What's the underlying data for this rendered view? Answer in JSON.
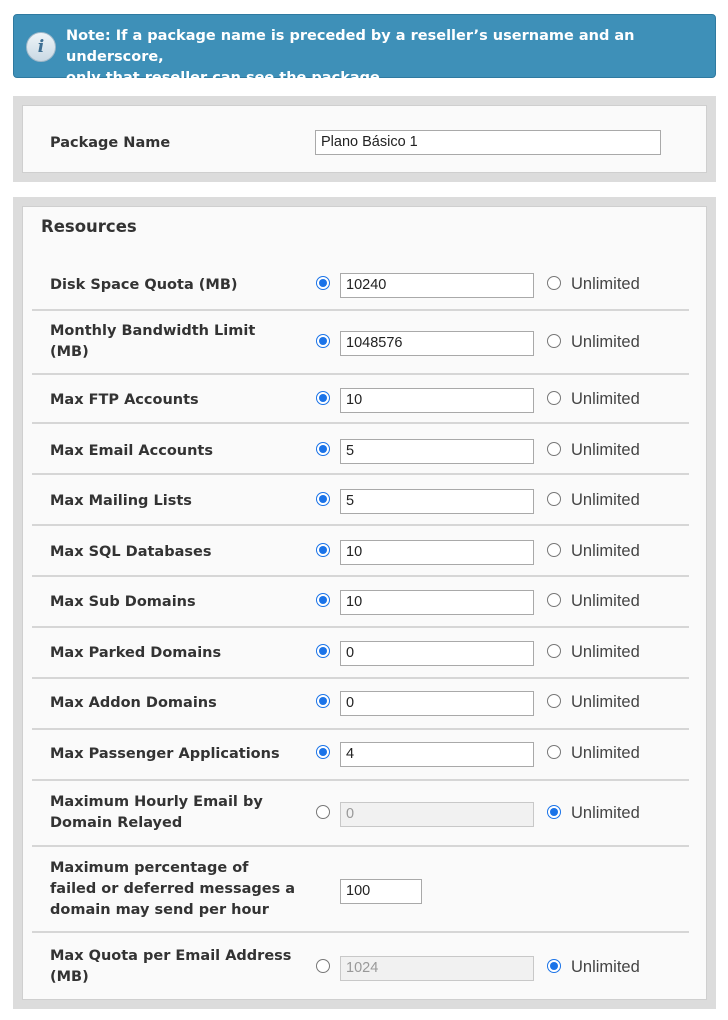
{
  "note": {
    "icon": "info-icon",
    "line1": "Note: If a package name is preceded by a reseller’s username and an underscore,",
    "line2": "only that reseller can see the package."
  },
  "package": {
    "label": "Package Name",
    "value": "Plano Básico 1"
  },
  "resources": {
    "title": "Resources",
    "unlimited_label": "Unlimited",
    "rows": [
      {
        "label1": "Disk Space Quota (MB)",
        "label2": "",
        "value": "10240",
        "unlimited": false
      },
      {
        "label1": "Monthly Bandwidth Limit",
        "label2": "(MB)",
        "value": "1048576",
        "unlimited": false
      },
      {
        "label1": "Max FTP Accounts",
        "label2": "",
        "value": "10",
        "unlimited": false
      },
      {
        "label1": "Max Email Accounts",
        "label2": "",
        "value": "5",
        "unlimited": false
      },
      {
        "label1": "Max Mailing Lists",
        "label2": "",
        "value": "5",
        "unlimited": false
      },
      {
        "label1": "Max SQL Databases",
        "label2": "",
        "value": "10",
        "unlimited": false
      },
      {
        "label1": "Max Sub Domains",
        "label2": "",
        "value": "10",
        "unlimited": false
      },
      {
        "label1": "Max Parked Domains",
        "label2": "",
        "value": "0",
        "unlimited": false
      },
      {
        "label1": "Max Addon Domains",
        "label2": "",
        "value": "0",
        "unlimited": false
      },
      {
        "label1": "Max Passenger Applications",
        "label2": "",
        "value": "4",
        "unlimited": false
      },
      {
        "label1": "Maximum Hourly Email by",
        "label2": "Domain Relayed",
        "value": "0",
        "unlimited": true
      },
      {
        "label1": "Maximum percentage of",
        "label2": "failed or deferred messages a",
        "label3": "domain may send per hour",
        "value": "100"
      },
      {
        "label1": "Max Quota per Email Address",
        "label2": "(MB)",
        "value": "1024",
        "unlimited": true
      }
    ]
  },
  "colors": {
    "note_bg": "#3e90b8",
    "radio_checked": "#1a73e8"
  }
}
